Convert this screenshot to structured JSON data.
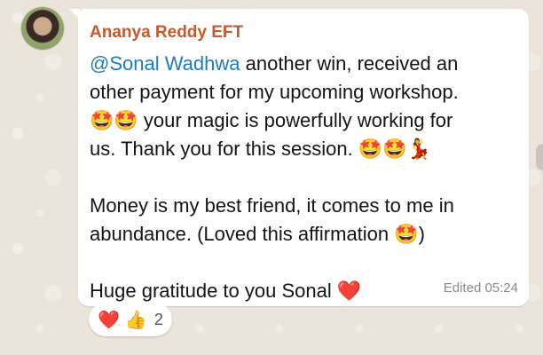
{
  "message": {
    "sender": "Ananya Reddy EFT",
    "lines": [
      {
        "mention": "@Sonal Wadhwa",
        "text": " another win, received an"
      },
      {
        "text": "other payment for my upcoming workshop."
      },
      {
        "text": "🤩🤩 your magic is powerfully working for"
      },
      {
        "text": "us. Thank you for this session. 🤩🤩💃"
      },
      {
        "text": ""
      },
      {
        "text": "Money is my best friend, it comes to me in"
      },
      {
        "text": "abundance. (Loved this affirmation 🤩)"
      },
      {
        "text": ""
      },
      {
        "text": "Huge gratitude to you Sonal ❤️"
      }
    ],
    "meta": "Edited 05:24"
  },
  "reactions": {
    "items": [
      "❤️",
      "👍"
    ],
    "count": "2"
  },
  "icons": {
    "avatar": "user-avatar-photo"
  },
  "colors": {
    "sender": "#c55a2f",
    "mention": "#1f7bbf",
    "bubble": "#ffffff",
    "background": "#ebe4da"
  }
}
